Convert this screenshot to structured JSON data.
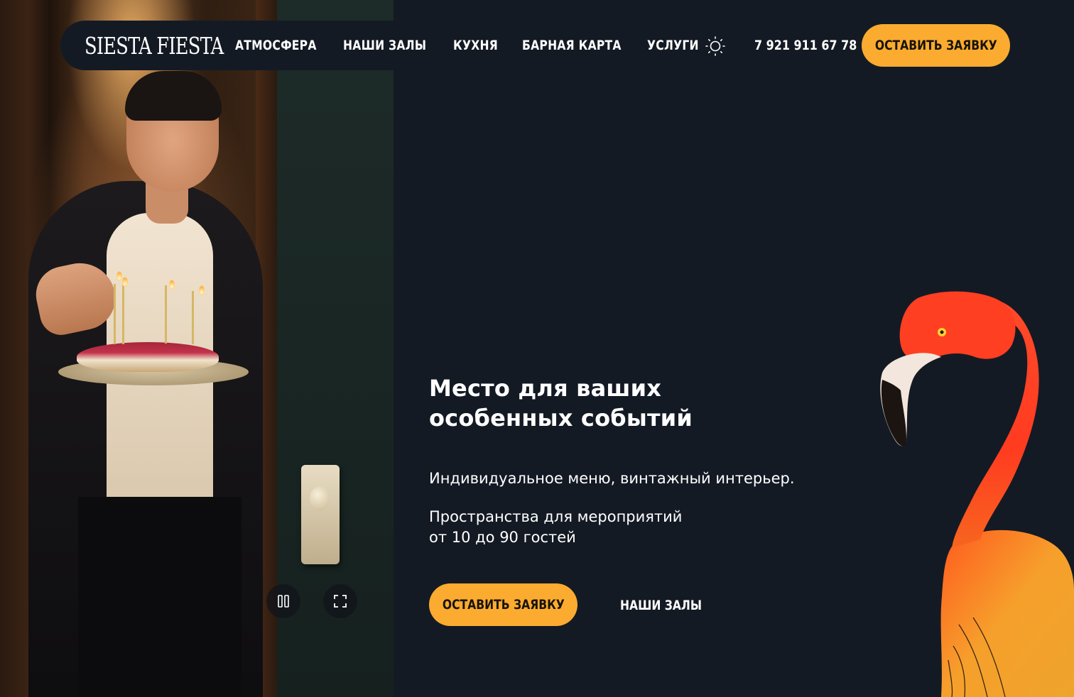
{
  "brand": {
    "logo_text": "SIESTA FIESTA"
  },
  "nav": {
    "items": [
      {
        "label": "АТМОСФЕРА"
      },
      {
        "label": "НАШИ ЗАЛЫ"
      },
      {
        "label": "КУХНЯ"
      },
      {
        "label": "БАРНАЯ КАРТА"
      },
      {
        "label": "УСЛУГИ"
      }
    ]
  },
  "header": {
    "theme_toggle_icon": "sun-icon",
    "phone": "7 921 911 67 78",
    "cta_label": "ОСТАВИТЬ ЗАЯВКУ"
  },
  "hero": {
    "title_line1": "Место для ваших",
    "title_line2": "особенных событий",
    "subtitle": "Индивидуальное меню, винтажный интерьер.",
    "capacity_line1": "Пространства для мероприятий",
    "capacity_line2": "от 10 до 90 гостей",
    "cta_label": "ОСТАВИТЬ ЗАЯВКУ",
    "secondary_link": "НАШИ ЗАЛЫ"
  },
  "video_controls": {
    "pause_icon": "pause-icon",
    "fullscreen_icon": "fullscreen-icon"
  },
  "colors": {
    "background": "#141a24",
    "accent": "#fbab2f",
    "text": "#ffffff"
  }
}
